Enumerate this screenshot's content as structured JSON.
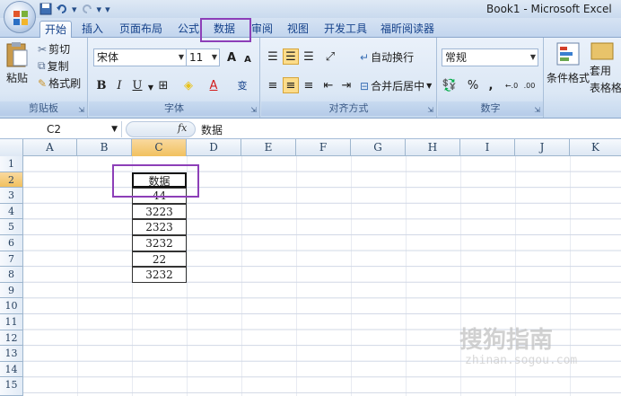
{
  "window": {
    "title": "Book1 - Microsoft Excel"
  },
  "quick_access": {
    "save_icon": "save-icon",
    "undo_icon": "undo-icon",
    "redo_icon": "redo-icon",
    "customize": "▾"
  },
  "tabs": [
    {
      "label": "开始",
      "active": true
    },
    {
      "label": "插入"
    },
    {
      "label": "页面布局"
    },
    {
      "label": "公式"
    },
    {
      "label": "数据"
    },
    {
      "label": "审阅"
    },
    {
      "label": "视图"
    },
    {
      "label": "开发工具"
    },
    {
      "label": "福昕阅读器"
    }
  ],
  "ribbon": {
    "clipboard": {
      "label": "剪贴板",
      "paste": "粘贴",
      "cut": "剪切",
      "copy": "复制",
      "format_painter": "格式刷"
    },
    "font": {
      "label": "字体",
      "name": "宋体",
      "size": "11",
      "bold": "B",
      "italic": "I",
      "underline": "U",
      "grow": "A",
      "shrink": "A",
      "wen": "变"
    },
    "alignment": {
      "label": "对齐方式",
      "wrap": "自动换行",
      "merge": "合并后居中"
    },
    "number": {
      "label": "数字",
      "format": "常规",
      "percent": "%",
      "comma": ",",
      "inc_dec": "+.0 .00",
      "dec_dec": ".00 +.0"
    },
    "styles": {
      "cond_format": "条件格式",
      "table_format_line1": "套用",
      "table_format_line2": "表格格"
    }
  },
  "formula_bar": {
    "name_box": "C2",
    "fx": "fx",
    "content": "数据"
  },
  "grid": {
    "columns": [
      "A",
      "B",
      "C",
      "D",
      "E",
      "F",
      "G",
      "H",
      "I",
      "J",
      "K"
    ],
    "selected_column": "C",
    "rows": [
      "1",
      "2",
      "3",
      "4",
      "5",
      "6",
      "7",
      "8",
      "9",
      "10",
      "11",
      "12",
      "13",
      "14",
      "15"
    ],
    "selected_row": "2",
    "column_c_values": [
      "数据",
      "44",
      "3223",
      "2323",
      "3232",
      "22",
      "3232"
    ]
  },
  "highlight_color": "#8d3fb8",
  "watermark": {
    "line1": "搜狗指南",
    "line2": "zhinan.sogou.com"
  }
}
